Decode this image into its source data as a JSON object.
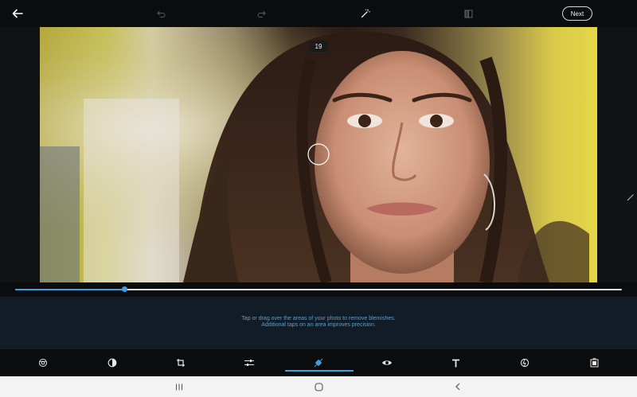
{
  "toolbar": {
    "next_label": "Next"
  },
  "icons": {
    "back": "back-arrow-icon",
    "undo": "undo-icon",
    "redo": "redo-icon",
    "auto_fix": "magic-wand-icon",
    "compare": "compare-icon"
  },
  "canvas": {
    "brush_size_badge": "19"
  },
  "slider": {
    "value_fraction": 0.18
  },
  "hint": {
    "line1": "Tap or drag over the areas of your photo to remove blemishes.",
    "line2": "Additional taps on an area improves precision."
  },
  "tools": [
    {
      "name": "looks-icon"
    },
    {
      "name": "filters-icon"
    },
    {
      "name": "crop-icon"
    },
    {
      "name": "adjust-icon"
    },
    {
      "name": "heal-icon",
      "active": true
    },
    {
      "name": "red-eye-icon"
    },
    {
      "name": "text-icon"
    },
    {
      "name": "stickers-icon"
    },
    {
      "name": "frames-icon"
    }
  ],
  "colors": {
    "accent": "#3da0e0",
    "hint_text": "#5c9fcf",
    "hint_bg": "#121c26",
    "toolbar_bg": "#0b0c0e",
    "nav_bg": "#f3f3f3"
  }
}
